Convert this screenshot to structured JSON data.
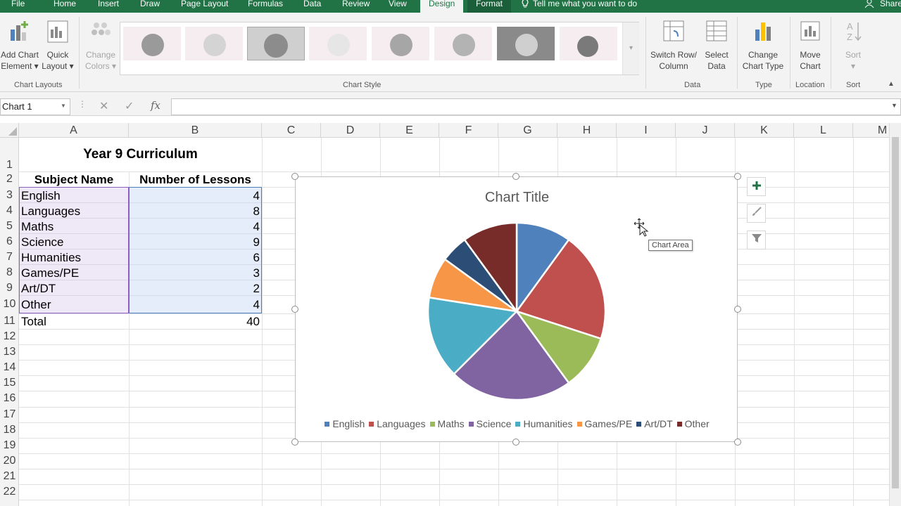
{
  "tabs": [
    "File",
    "Home",
    "Insert",
    "Draw",
    "Page Layout",
    "Formulas",
    "Data",
    "Review",
    "View",
    "Design",
    "Format"
  ],
  "tell_me": "Tell me what you want to do",
  "share": "Share",
  "ribbon": {
    "add_chart_element": "Add Chart Element",
    "quick_layout": "Quick Layout",
    "change_colors": "Change Colors",
    "chart_layouts_label": "Chart Layouts",
    "chart_styles_label": "Chart Style",
    "switch_row_column": "Switch Row/ Column",
    "select_data": "Select Data",
    "data_label": "Data",
    "change_chart_type": "Change Chart Type",
    "type_label": "Type",
    "move_chart": "Move Chart",
    "location_label": "Location",
    "sort": "Sort",
    "sort_label": "Sort"
  },
  "formula_bar": {
    "name_box": "Chart 1",
    "cancel_icon": "✕",
    "enter_icon": "✓",
    "fx": "fx",
    "formula": ""
  },
  "columns": [
    "A",
    "B",
    "C",
    "D",
    "E",
    "F",
    "G",
    "H",
    "I",
    "J",
    "K",
    "L",
    "M"
  ],
  "rows": [
    "1",
    "2",
    "3",
    "4",
    "5",
    "6",
    "7",
    "8",
    "9",
    "10",
    "11",
    "12",
    "13",
    "14",
    "15",
    "16",
    "17",
    "18",
    "19",
    "20",
    "21",
    "22"
  ],
  "sheet": {
    "title": "Year 9 Curriculum",
    "header_subject": "Subject Name",
    "header_lessons": "Number of Lessons",
    "subjects": [
      "English",
      "Languages",
      "Maths",
      "Science",
      "Humanities",
      "Games/PE",
      "Art/DT",
      "Other"
    ],
    "lessons": [
      "4",
      "8",
      "4",
      "9",
      "6",
      "3",
      "2",
      "4"
    ],
    "total_label": "Total",
    "total_value": "40"
  },
  "chart_data": {
    "type": "pie",
    "title": "Chart Title",
    "categories": [
      "English",
      "Languages",
      "Maths",
      "Science",
      "Humanities",
      "Games/PE",
      "Art/DT",
      "Other"
    ],
    "values": [
      4,
      8,
      4,
      9,
      6,
      3,
      2,
      4
    ],
    "colors": [
      "#4f81bd",
      "#c0504d",
      "#9bbb59",
      "#8064a2",
      "#4bacc6",
      "#f79646",
      "#2c4d75",
      "#772c2a"
    ],
    "legend": "bottom"
  },
  "chart_ui": {
    "tooltip": "Chart Area",
    "add_icon": "plus-icon",
    "style_icon": "brush-icon",
    "filter_icon": "filter-icon"
  }
}
